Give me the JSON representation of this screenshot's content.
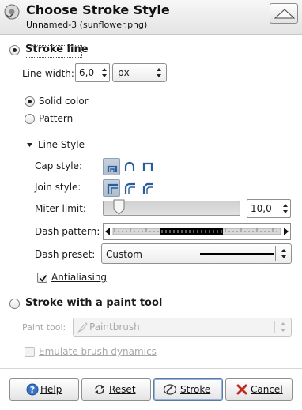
{
  "dialog": {
    "title": "Choose Stroke Style",
    "subtitle": "Unnamed-3 (sunflower.png)"
  },
  "stroke_line": {
    "label": "Stroke line",
    "selected": true,
    "line_width_label": "Line width:",
    "line_width_value": "6,0",
    "unit": "px",
    "fill_options": [
      {
        "label": "Solid color",
        "selected": true
      },
      {
        "label": "Pattern",
        "selected": false
      }
    ],
    "line_style": {
      "expander_label": "Line Style",
      "cap_style_label": "Cap style:",
      "join_style_label": "Join style:",
      "miter_limit_label": "Miter limit:",
      "miter_limit_value": "10,0",
      "miter_limit_slider_fraction": 0.1,
      "dash_pattern_label": "Dash pattern:",
      "dash_preset_label": "Dash preset:",
      "dash_preset_value": "Custom",
      "antialiasing_label": "Antialiasing",
      "antialiasing_checked": true
    }
  },
  "stroke_paint_tool": {
    "label": "Stroke with a paint tool",
    "selected": false,
    "paint_tool_label": "Paint tool:",
    "paint_tool_value": "Paintbrush",
    "emulate_label": "Emulate brush dynamics",
    "emulate_checked": false
  },
  "buttons": {
    "help": "Help",
    "reset": "Reset",
    "stroke": "Stroke",
    "cancel": "Cancel"
  },
  "colors": {
    "active_toggle": "#aebccd",
    "dash_on": "#000000",
    "disabled_text": "#a8a8a8"
  }
}
